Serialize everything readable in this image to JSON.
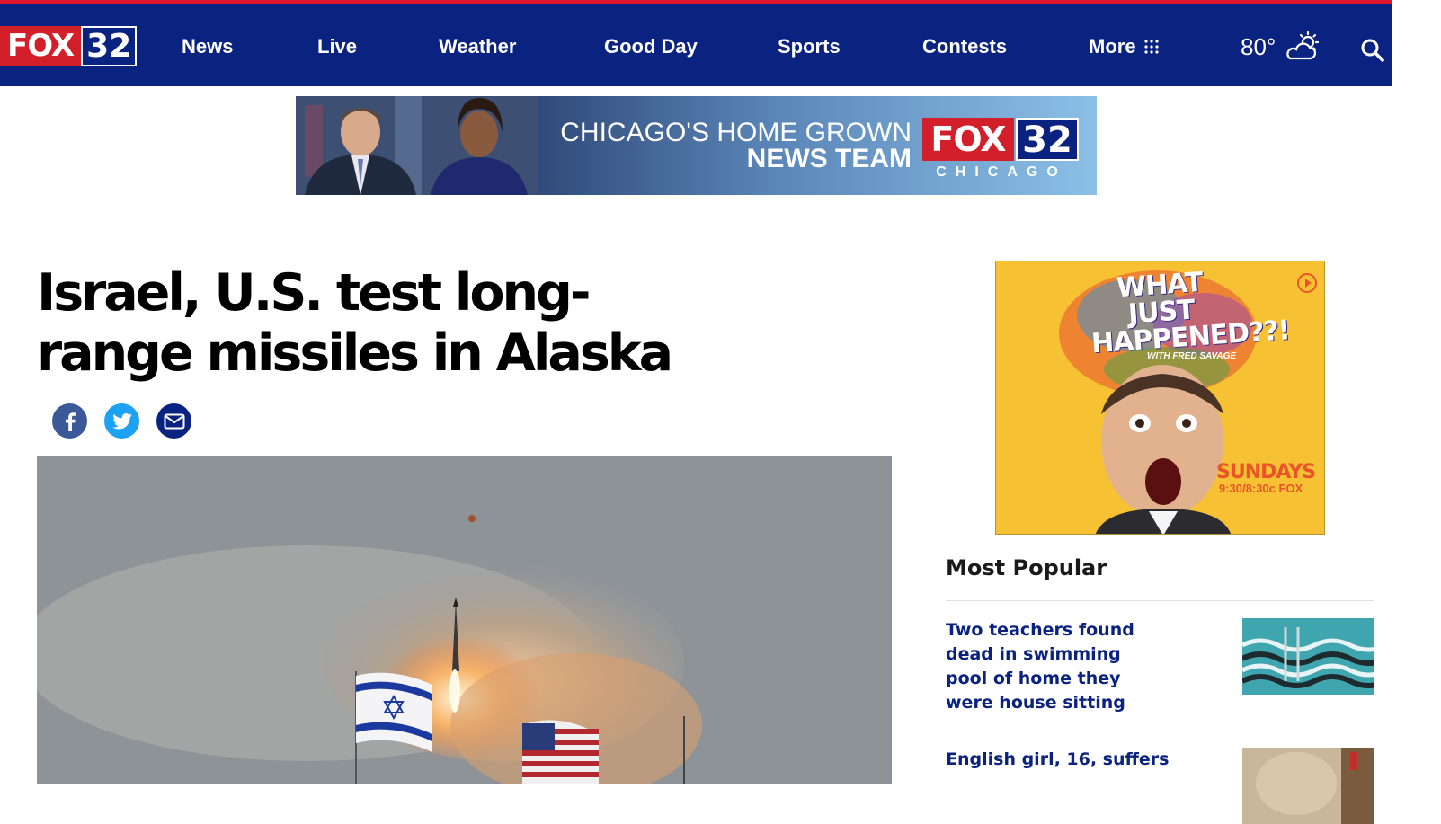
{
  "header": {
    "logo": {
      "fox": "FOX",
      "number": "32"
    },
    "nav": [
      {
        "label": "News"
      },
      {
        "label": "Live"
      },
      {
        "label": "Weather"
      },
      {
        "label": "Good Day"
      },
      {
        "label": "Sports"
      },
      {
        "label": "Contests"
      },
      {
        "label": "More"
      }
    ],
    "weather": {
      "temperature": "80°",
      "icon": "partly-cloudy-sun-icon"
    },
    "search_icon": "search-icon"
  },
  "banner_ad": {
    "line1": "CHICAGO'S HOME GROWN",
    "line2": "NEWS TEAM",
    "logo_fox": "FOX",
    "logo_number": "32",
    "logo_city": "CHICAGO"
  },
  "article": {
    "headline": "Israel, U.S. test long-range missiles in Alaska",
    "share": [
      {
        "name": "facebook",
        "icon": "facebook-icon",
        "color": "#3b5998"
      },
      {
        "name": "twitter",
        "icon": "twitter-icon",
        "color": "#1da1f2"
      },
      {
        "name": "email",
        "icon": "email-icon",
        "color": "#0a2280"
      }
    ]
  },
  "side_ad": {
    "title": "WHAT JUST HAPPENED??!",
    "subtitle": "WITH FRED SAVAGE",
    "schedule_day": "SUNDAYS",
    "schedule_time": "9:30/8:30c FOX"
  },
  "most_popular": {
    "title": "Most Popular",
    "items": [
      {
        "title": "Two teachers found dead in swimming pool of home they were house sitting"
      },
      {
        "title": "English girl, 16, suffers"
      }
    ]
  },
  "colors": {
    "nav_bg": "#0a2280",
    "accent_red": "#e0142a",
    "link_blue": "#0a2280"
  }
}
